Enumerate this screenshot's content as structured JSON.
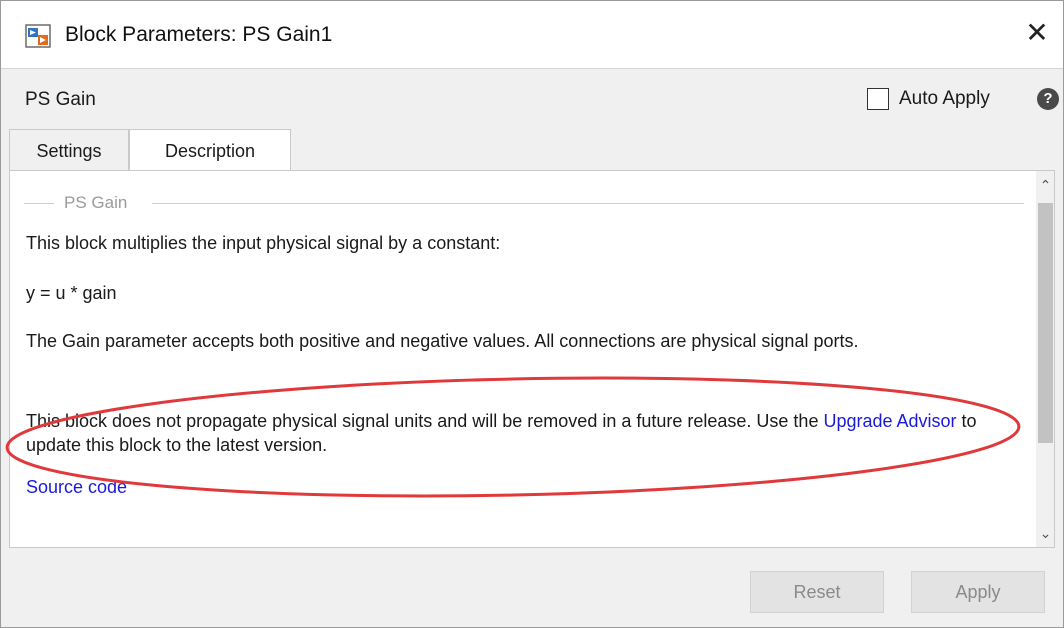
{
  "window": {
    "title": "Block Parameters: PS Gain1",
    "close_glyph": "✕"
  },
  "header": {
    "block_name": "PS Gain",
    "auto_apply_label": "Auto Apply",
    "help_glyph": "?"
  },
  "tabs": [
    {
      "label": "Settings",
      "selected": false
    },
    {
      "label": "Description",
      "selected": true
    }
  ],
  "content": {
    "group_title": "PS Gain",
    "paragraphs": [
      "This block multiplies the input physical signal by a constant:",
      "y = u * gain",
      "The Gain parameter accepts both positive and negative values. All connections are physical signal ports."
    ],
    "deprecation": {
      "text_before": "This block does not propagate physical signal units and will be removed in a future release. Use the ",
      "link": "Upgrade Advisor",
      "text_after": " to update this block to the latest version."
    },
    "source_link": "Source code"
  },
  "footer": {
    "reset_label": "Reset",
    "apply_label": "Apply"
  },
  "colors": {
    "link": "#1a1adb",
    "annotation": "#e0393b",
    "disabled_button_text": "#8a8a8a"
  },
  "icons": {
    "app": "simulink-block-icon",
    "help": "help-icon",
    "close": "close-icon"
  }
}
